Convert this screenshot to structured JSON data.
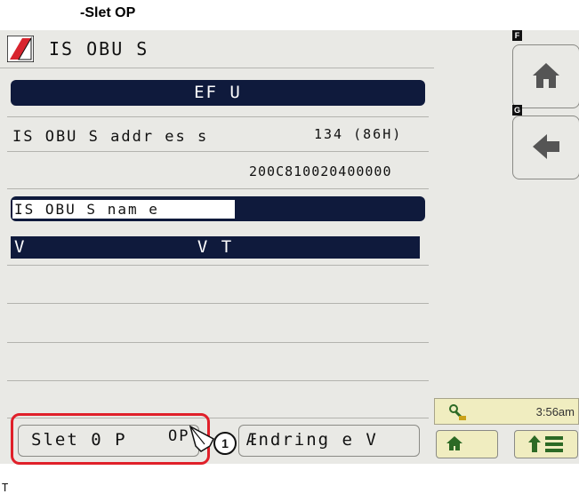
{
  "caption": "-Slet OP",
  "title_bar": {
    "title": "IS OBU S"
  },
  "section_header": "EF U",
  "rows": {
    "address_label": "IS OBU S addr es s",
    "address_value": "134 (86H)",
    "id_value": "200C810020400000",
    "name_label": "IS OBU S nam e",
    "vt_left": "V",
    "vt_label": "V T"
  },
  "buttons": {
    "delete_label": "Slet 0 P",
    "delete_suffix": "OP",
    "change_label": "Ændring e V"
  },
  "callout_number": "1",
  "corner_text": "T",
  "right_panel": {
    "home_tag": "F",
    "back_tag": "G",
    "status_time": "3:56am"
  },
  "colors": {
    "navy": "#0f1a3c",
    "screen_bg": "#e9e9e5",
    "status_bg": "#f0edc0",
    "highlight_red": "#e0202a",
    "icon_green": "#2c6a25"
  },
  "icons": {
    "logo": "brand-logo-icon",
    "home": "home-icon",
    "back": "arrow-left-icon",
    "status": "machine-status-icon",
    "home_small": "home-icon",
    "up_grid": "up-arrow-grid-icon"
  }
}
